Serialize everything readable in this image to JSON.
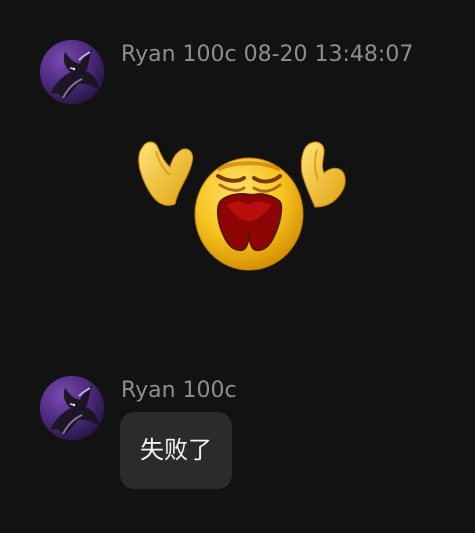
{
  "messages": [
    {
      "sender": "Ryan 100c",
      "timestamp": "08-20 13:48:07",
      "header": "Ryan 100c 08-20 13:48:07",
      "content_type": "sticker",
      "sticker_icon": "crying-emoji-icon"
    },
    {
      "sender": "Ryan 100c",
      "header": "Ryan 100c",
      "content_type": "text",
      "text": "失败了"
    }
  ],
  "colors": {
    "background": "#121212",
    "meta_text": "#8e8e8e",
    "bubble": "#2b2b2b",
    "bubble_text": "#f2f2f2",
    "avatar_bg": "#4a2a78"
  },
  "icons": {
    "avatar": "dragon-avatar-icon",
    "sticker": "crying-emoji-icon"
  }
}
